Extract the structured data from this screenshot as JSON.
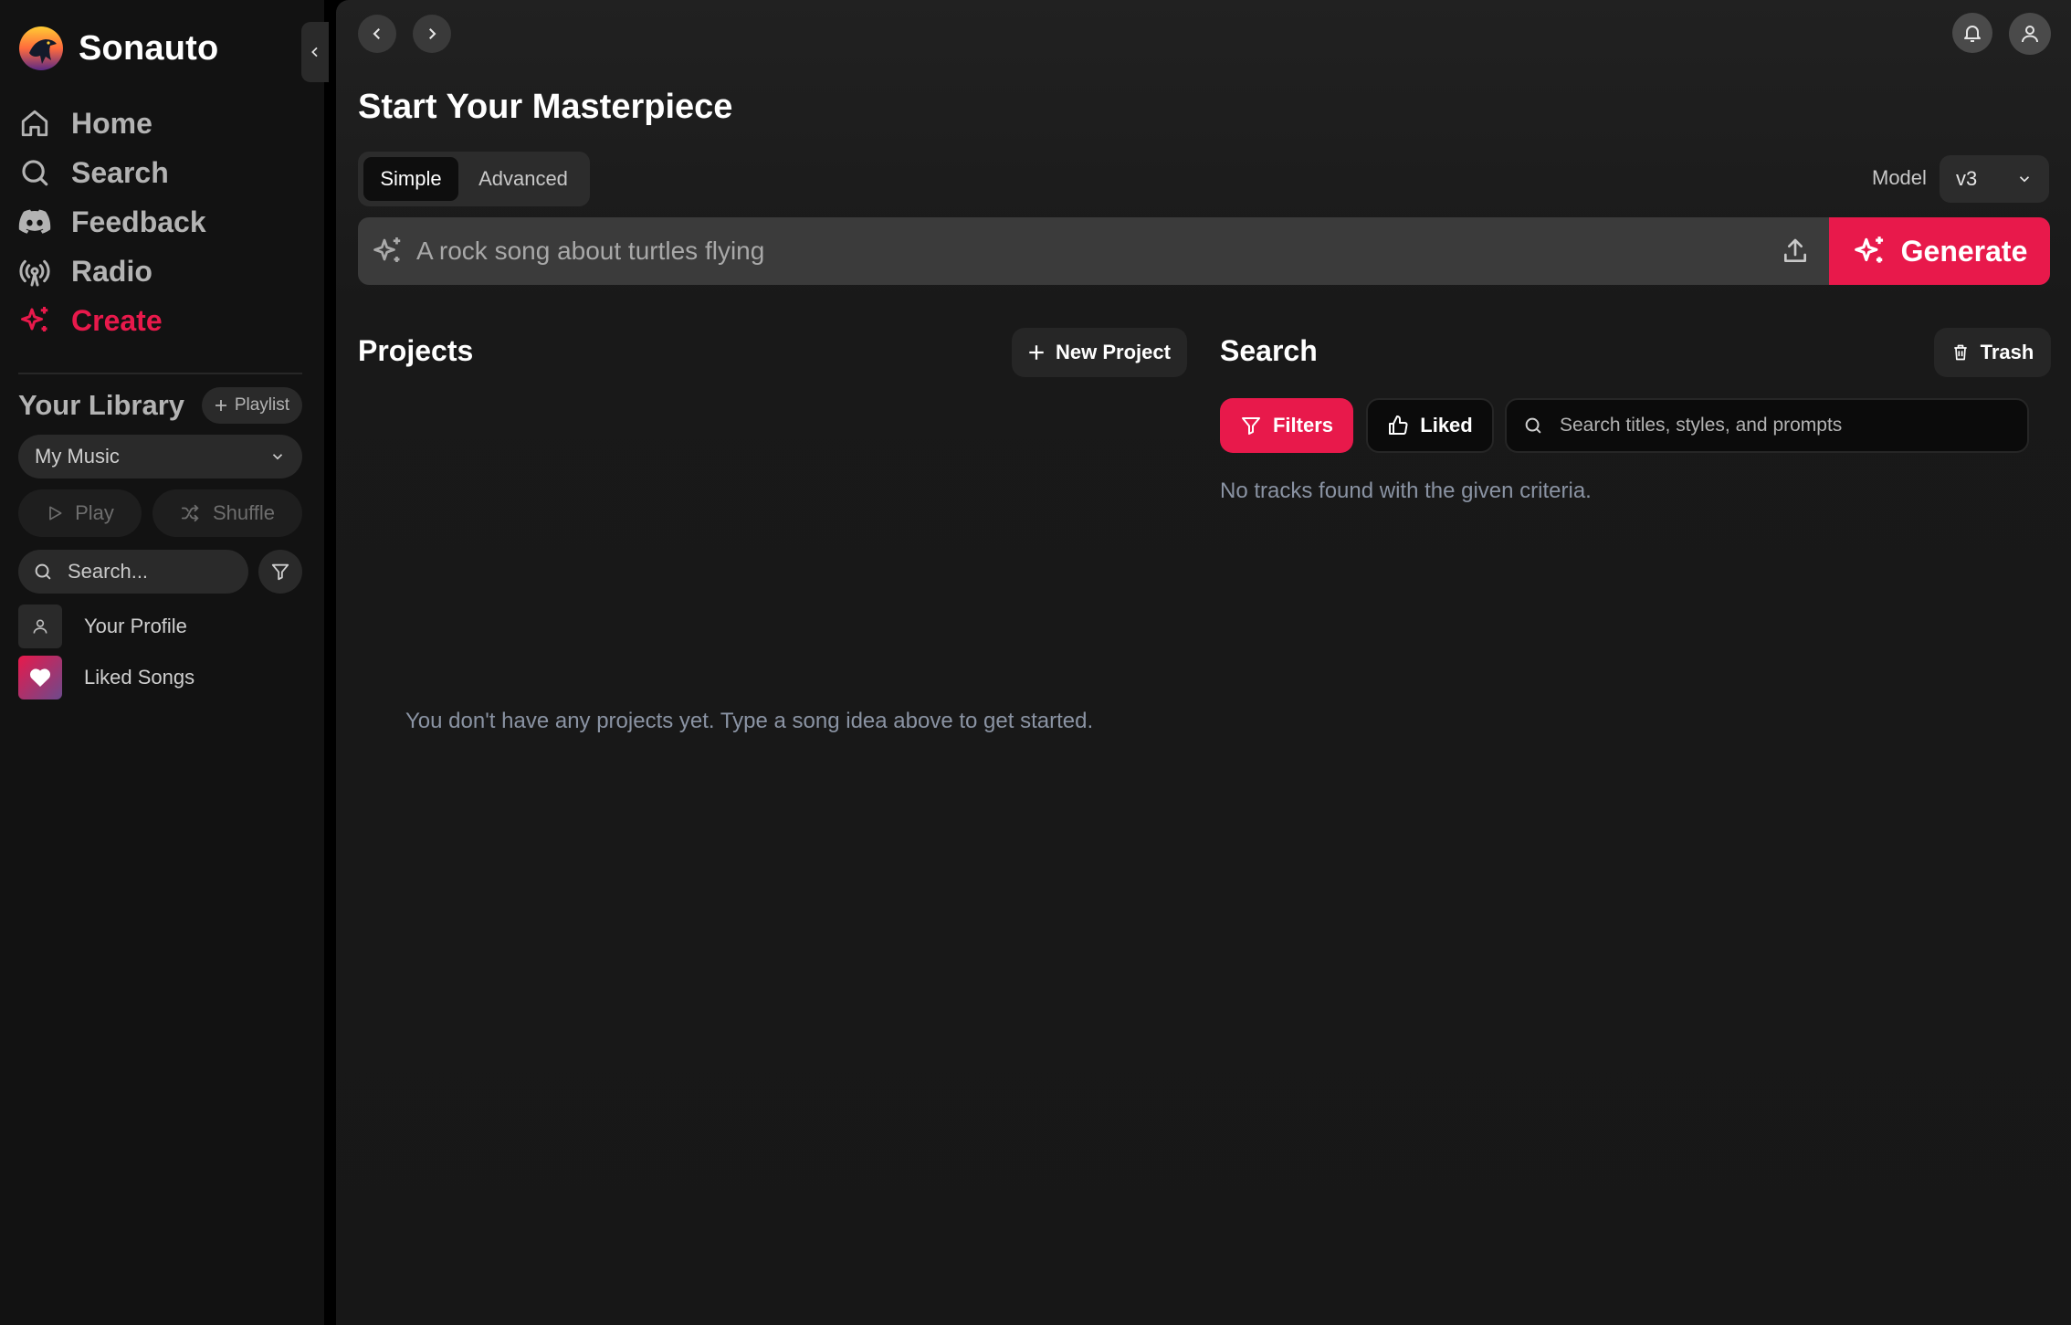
{
  "brand": {
    "name": "Sonauto"
  },
  "sidebar": {
    "nav": [
      {
        "label": "Home",
        "icon": "home-icon"
      },
      {
        "label": "Search",
        "icon": "search-icon"
      },
      {
        "label": "Feedback",
        "icon": "discord-icon"
      },
      {
        "label": "Radio",
        "icon": "radio-icon"
      },
      {
        "label": "Create",
        "icon": "sparkle-icon",
        "active": true
      }
    ],
    "library": {
      "title": "Your Library",
      "playlist_button": "Playlist",
      "selected": "My Music",
      "play_label": "Play",
      "shuffle_label": "Shuffle",
      "search_placeholder": "Search...",
      "items": [
        {
          "label": "Your Profile",
          "icon": "user-icon"
        },
        {
          "label": "Liked Songs",
          "icon": "heart-icon"
        }
      ]
    }
  },
  "main": {
    "title": "Start Your Masterpiece",
    "modes": [
      "Simple",
      "Advanced"
    ],
    "selected_mode": "Simple",
    "model_label": "Model",
    "model_value": "v3",
    "prompt_placeholder": "A rock song about turtles flying",
    "generate_label": "Generate",
    "projects": {
      "title": "Projects",
      "new_button": "New Project",
      "empty_text": "You don't have any projects yet. Type a song idea above to get started."
    },
    "search": {
      "title": "Search",
      "trash_label": "Trash",
      "filters_label": "Filters",
      "liked_label": "Liked",
      "placeholder": "Search titles, styles, and prompts",
      "empty_text": "No tracks found with the given criteria."
    }
  },
  "colors": {
    "accent": "#e8194b",
    "sidebar_bg": "#121212",
    "main_bg": "#191919",
    "muted_text": "#8a93a3"
  }
}
